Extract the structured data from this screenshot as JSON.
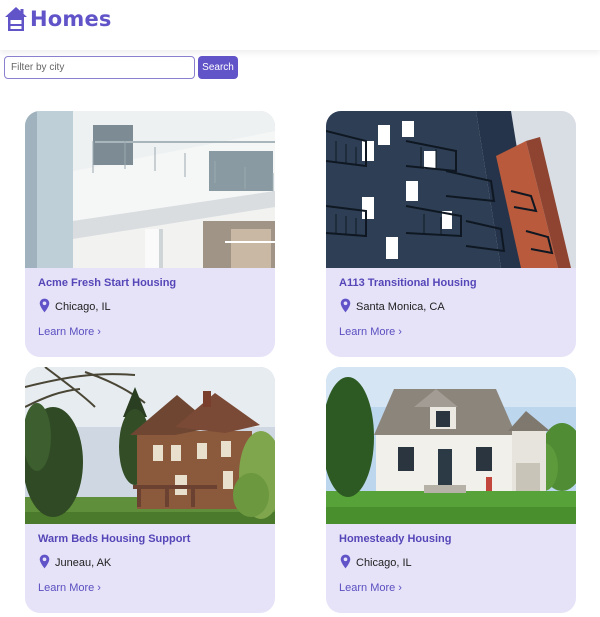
{
  "app": {
    "title": "Homes",
    "brand_color": "#6153c8",
    "logo_icon": "house-icon"
  },
  "filter": {
    "placeholder": "Filter by city",
    "value": "",
    "button_label": "Search"
  },
  "card_background": "#e6e3f8",
  "listings": [
    {
      "name": "Acme Fresh Start Housing",
      "location": "Chicago, IL",
      "link": "Learn More ›",
      "photo": "white modern apartment building with balconies"
    },
    {
      "name": "A113 Transitional Housing",
      "location": "Santa Monica, CA",
      "link": "Learn More ›",
      "photo": "dark blue and red apartment tower with balconies"
    },
    {
      "name": "Warm Beds Housing Support",
      "location": "Juneau, AK",
      "link": "Learn More ›",
      "photo": "brick victorian house with trees"
    },
    {
      "name": "Homesteady Housing",
      "location": "Chicago, IL",
      "link": "Learn More ›",
      "photo": "white house with grey roof and lawn"
    }
  ]
}
